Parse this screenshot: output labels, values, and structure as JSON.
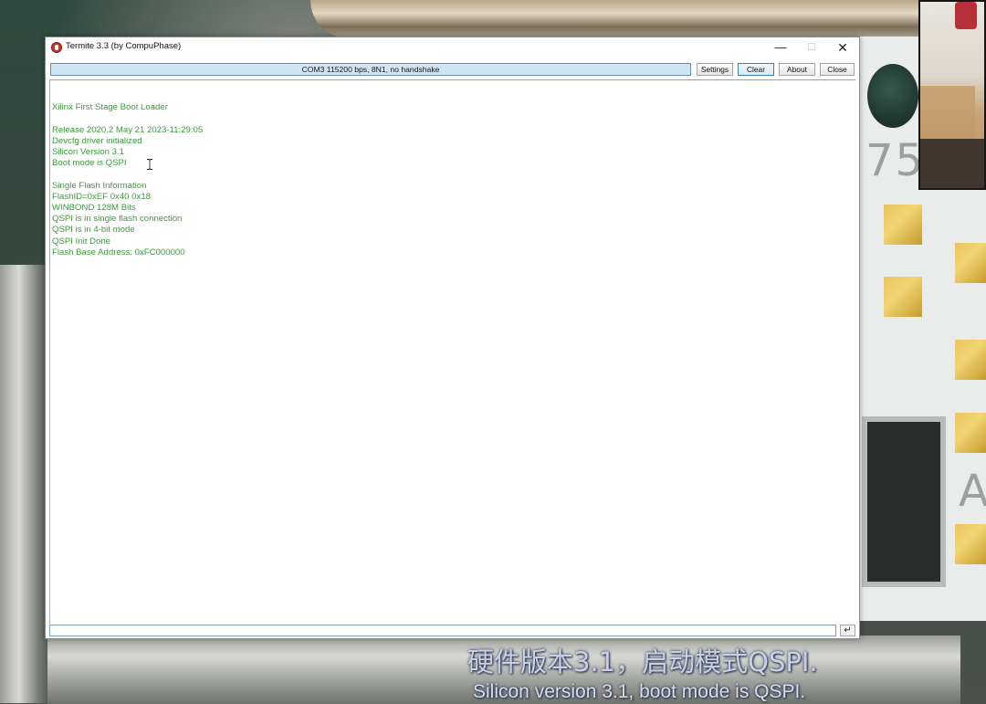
{
  "window": {
    "title": "Termite 3.3 (by CompuPhase)",
    "minimize_glyph": "—",
    "maximize_glyph": "☐",
    "close_glyph": "✕"
  },
  "toolbar": {
    "status": "COM3 115200 bps, 8N1, no handshake",
    "settings_label": "Settings",
    "clear_label": "Clear",
    "about_label": "About",
    "close_label": "Close"
  },
  "terminal": {
    "text_color": "#3d9a3d",
    "lines": [
      "",
      "",
      "Xilinx First Stage Boot Loader",
      "",
      "Release 2020.2 May 21 2023-11:29:05",
      "Devcfg driver initialized",
      "Silicon Version 3.1",
      "Boot mode is QSPI",
      "",
      "Single Flash Information",
      "FlashID=0xEF 0x40 0x18",
      "WINBOND 128M Bits",
      "QSPI is in single flash connection",
      "QSPI is in 4-bit mode",
      "QSPI Init Done",
      "Flash Base Address: 0xFC000000"
    ]
  },
  "input": {
    "value": "",
    "enter_glyph": "↵"
  },
  "pcb": {
    "text_top": "75",
    "text_bottom": "A"
  },
  "subtitles": {
    "chinese": "硬件版本3.1，启动模式QSPI.",
    "english": "Silicon version 3.1, boot mode is QSPI."
  }
}
